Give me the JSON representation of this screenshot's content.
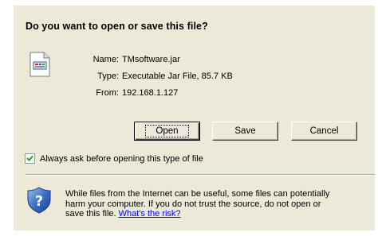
{
  "dialog": {
    "question": "Do you want to open or save this file?",
    "file": {
      "name_label": "Name:",
      "name_value": "TMsoftware.jar",
      "type_label": "Type:",
      "type_value": "Executable Jar File, 85.7 KB",
      "from_label": "From:",
      "from_value": "192.168.1.127",
      "icon": "jar-file-icon"
    },
    "buttons": {
      "open": "Open",
      "save": "Save",
      "cancel": "Cancel"
    },
    "checkbox": {
      "label": "Always ask before opening this type of file",
      "checked": true
    },
    "warning": {
      "icon": "shield-question-icon",
      "text_line1": "While files from the Internet can be useful, some files can potentially",
      "text_line2": "harm your computer. If you do not trust the source, do not open or",
      "text_line3_prefix": "save this file. ",
      "link": "What's the risk?"
    }
  },
  "colors": {
    "dialog_bg": "#ece9d8",
    "link": "#0000ff"
  }
}
